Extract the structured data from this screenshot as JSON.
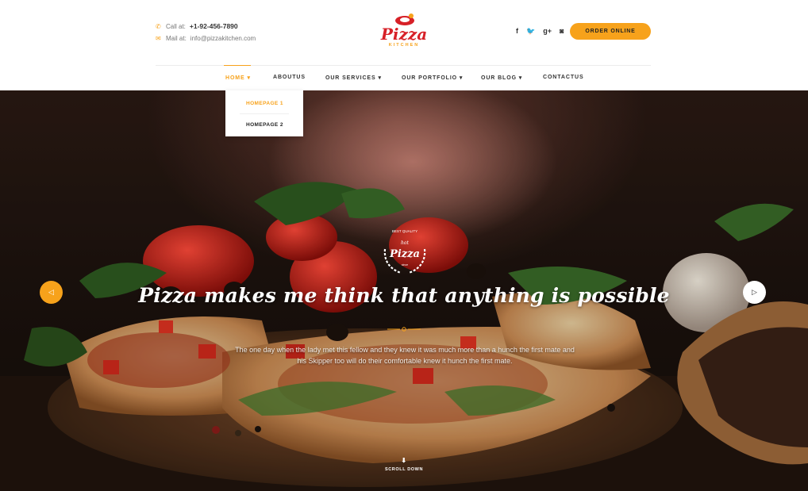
{
  "header": {
    "call_label": "Call at:",
    "phone": "+1-92-456-7890",
    "mail_label": "Mail at:",
    "email": "info@pizzakitchen.com",
    "logo_word": "Pizza",
    "logo_sub": "KITCHEN",
    "social": [
      "f",
      "t",
      "g+",
      "ig"
    ],
    "order_button": "ORDER ONLINE"
  },
  "nav": {
    "items": [
      {
        "label": "HOME",
        "arrow": "▾"
      },
      {
        "label": "ABOUTUS"
      },
      {
        "label": "OUR SERVICES",
        "arrow": "▾"
      },
      {
        "label": "OUR PORTFOLIO",
        "arrow": "▾"
      },
      {
        "label": "OUR BLOG",
        "arrow": "▾"
      },
      {
        "label": "CONTACTUS"
      }
    ],
    "dropdown": [
      "HOMEPAGE 1",
      "HOMEPAGE 2"
    ]
  },
  "hero": {
    "badge_top": "BEST QUALITY",
    "badge_hat": "hot",
    "badge_word": "Pizza",
    "badge_since": "since",
    "headline": "Pizza makes me think that anything is possible",
    "description": "The one day when the lady met this fellow and they knew it was much more than a hunch the first mate and his Skipper too will do their comfortable knew it hunch the first mate.",
    "prev_icon": "◁",
    "next_icon": "▷",
    "scroll_icon": "⬇",
    "scroll_label": "SCROLL DOWN"
  },
  "colors": {
    "accent": "#f7a21b",
    "logo_red": "#d72027"
  }
}
